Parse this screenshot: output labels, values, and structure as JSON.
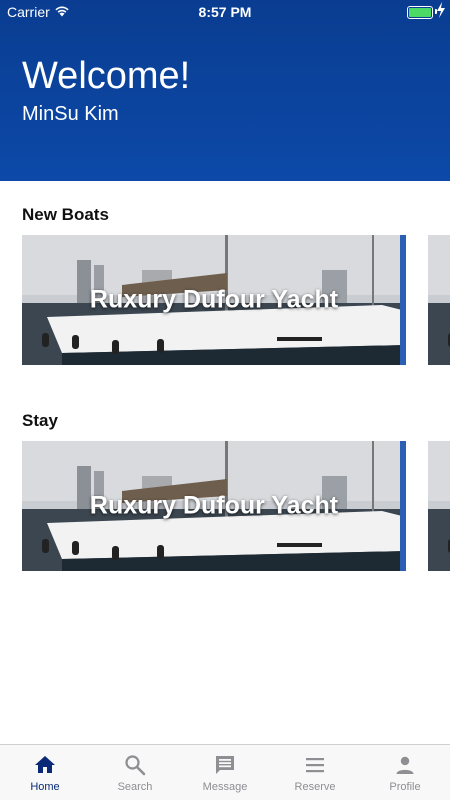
{
  "status_bar": {
    "carrier": "Carrier",
    "time": "8:57 PM",
    "battery_level": 1.0,
    "battery_color": "#4cd964"
  },
  "header": {
    "title": "Welcome!",
    "user_name": "MinSu Kim",
    "background_color": "#0c49a8"
  },
  "sections": [
    {
      "title": "New Boats",
      "cards": [
        {
          "title": "Ruxury Dufour Yacht",
          "image": "yacht-photo"
        },
        {
          "title": "",
          "image": "yacht-photo"
        }
      ]
    },
    {
      "title": "Stay",
      "cards": [
        {
          "title": "Ruxury Dufour Yacht",
          "image": "yacht-photo"
        },
        {
          "title": "",
          "image": "yacht-photo"
        }
      ]
    }
  ],
  "tab_bar": {
    "active_color": "#0a2a78",
    "inactive_color": "#8e8e93",
    "tabs": [
      {
        "label": "Home",
        "icon": "home-icon",
        "active": true
      },
      {
        "label": "Search",
        "icon": "search-icon",
        "active": false
      },
      {
        "label": "Message",
        "icon": "message-icon",
        "active": false
      },
      {
        "label": "Reserve",
        "icon": "list-icon",
        "active": false
      },
      {
        "label": "Profile",
        "icon": "person-icon",
        "active": false
      }
    ]
  }
}
